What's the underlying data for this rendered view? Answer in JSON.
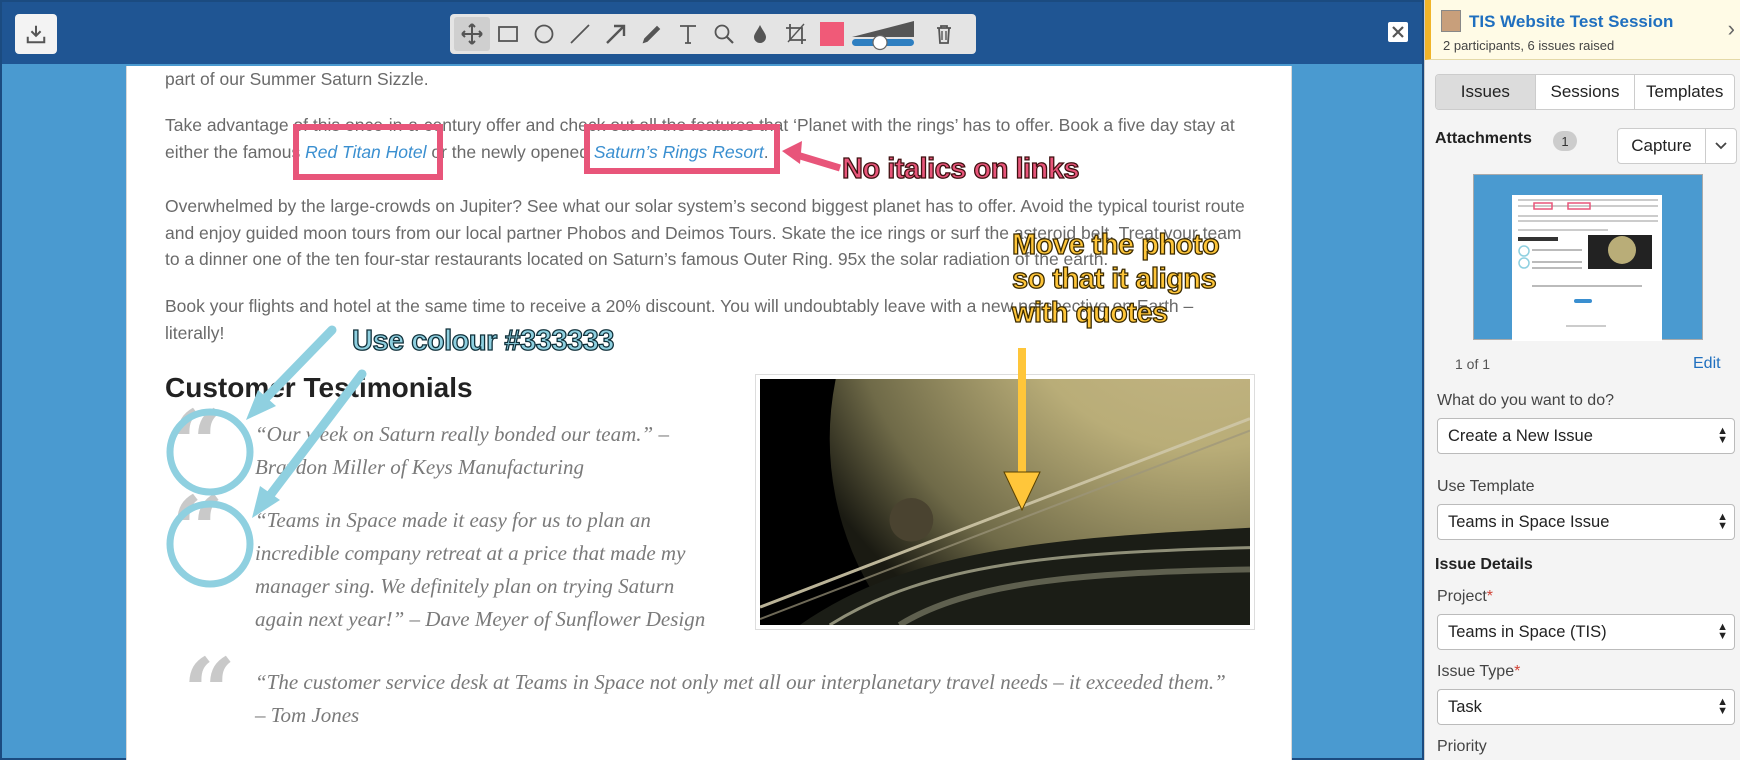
{
  "editor": {
    "close_symbol": "✕",
    "tools": [
      {
        "name": "move-tool-icon",
        "active": true
      },
      {
        "name": "rectangle-tool-icon"
      },
      {
        "name": "ellipse-tool-icon"
      },
      {
        "name": "line-tool-icon"
      },
      {
        "name": "arrow-tool-icon"
      },
      {
        "name": "pen-tool-icon"
      },
      {
        "name": "text-tool-icon"
      },
      {
        "name": "magnify-tool-icon"
      },
      {
        "name": "blur-tool-icon"
      },
      {
        "name": "crop-tool-icon"
      }
    ],
    "current_color": "#f05a78"
  },
  "page": {
    "p1": "part of our Summer Saturn Sizzle.",
    "p2_a": "Take advantage of this once-in-a-century offer and check out all the features that ‘Planet with the rings’ has to offer. Book a five day stay at either the famous ",
    "p2_link1": "Red Titan Hotel",
    "p2_b": " or the newly opened ",
    "p2_link2": "Saturn’s Rings Resort",
    "p2_c": ".",
    "p3": "Overwhelmed by the large-crowds on Jupiter? See what our solar system’s second biggest planet has to offer. Avoid the typical tourist route and enjoy guided moon tours from our local partner Phobos and Deimos Tours. Skate the ice rings or surf the asteroid belt. Treat your team to a dinner one of the ten four-star restaurants located on Saturn’s famous Outer Ring. 95x the solar radiation of the earth.",
    "p4": "Book your flights and hotel at the same time to receive a 20% discount. You will undoubtably leave with a new perspective on Earth – literally!",
    "heading": "Customer Testimonials",
    "quote_mark": "“",
    "quotes": [
      "“Our week on Saturn really bonded our team.” – Braydon Miller of Keys Manufacturing",
      "“Teams in Space made it easy for us to plan an incredible company retreat at a price that made my manager sing. We definitely plan on trying Saturn again next year!” – Dave Meyer of Sunflower Design",
      "“The customer service desk at Teams in Space not only met all our interplanetary travel needs – it exceeded them.” – Tom Jones"
    ]
  },
  "annotations": {
    "links": "No italics on links",
    "photo": "Move the photo so that it aligns with quotes",
    "colour": "Use colour #333333",
    "colors": {
      "red": "#e8557a",
      "blue": "#8fd0e0",
      "yellow": "#ffc63a"
    }
  },
  "sidebar": {
    "session_title": "TIS Website Test Session",
    "session_sub": "2 participants, 6 issues raised",
    "chevron": "›",
    "tabs": [
      "Issues",
      "Sessions",
      "Templates"
    ],
    "attachments_label": "Attachments",
    "attachments_count": "1",
    "capture_label": "Capture",
    "pager": "1 of 1",
    "edit_label": "Edit",
    "what_label": "What do you want to do?",
    "what_value": "Create a New Issue",
    "template_label": "Use Template",
    "template_value": "Teams in Space Issue",
    "issue_details": "Issue Details",
    "project_label": "Project",
    "project_value": "Teams in Space (TIS)",
    "issue_type_label": "Issue Type",
    "issue_type_value": "Task",
    "priority_label": "Priority",
    "required_mark": "*"
  }
}
